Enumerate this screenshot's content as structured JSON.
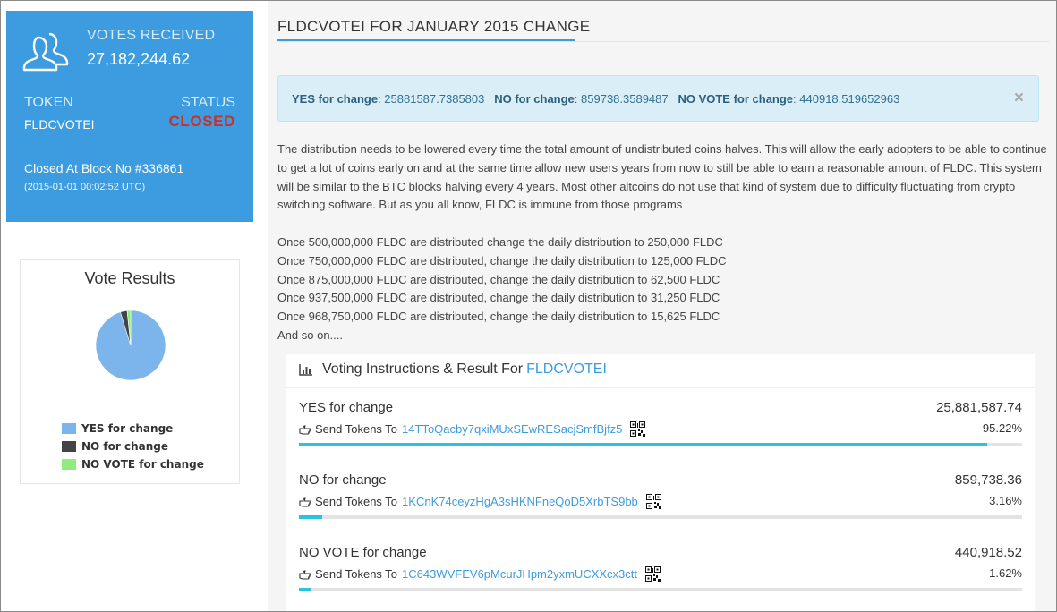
{
  "stat_card": {
    "votes_label": "VOTES RECEIVED",
    "votes_value": "27,182,244.62",
    "token_label": "TOKEN",
    "token_value": "FLDCVOTEI",
    "status_label": "STATUS",
    "status_value": "CLOSED",
    "closed_block": "Closed At Block No #336861",
    "closed_time": "(2015-01-01 00:02:52 UTC)",
    "card_color": "#3d9ce0",
    "status_color": "#c9302c"
  },
  "results": {
    "title": "Vote Results",
    "legend": [
      {
        "label": "YES for change",
        "color": "#7cb5ec"
      },
      {
        "label": "NO for change",
        "color": "#434348"
      },
      {
        "label": "NO VOTE for change",
        "color": "#90ed7d"
      }
    ]
  },
  "chart_data": {
    "type": "pie",
    "title": "Vote Results",
    "categories": [
      "YES for change",
      "NO for change",
      "NO VOTE for change"
    ],
    "values": [
      25881587.7385803,
      859738.3589487,
      440918.519652963
    ],
    "colors": [
      "#7cb5ec",
      "#434348",
      "#90ed7d"
    ],
    "legend": "bottom"
  },
  "main": {
    "page_title": "FLDCVOTEI FOR JANUARY 2015 CHANGE",
    "alert": {
      "yes_label": "YES for change",
      "yes_value": ": 25881587.7385803",
      "no_label": "NO for change",
      "no_value": ": 859738.3589487",
      "novote_label": "NO VOTE for change",
      "novote_value": ": 440918.519652963",
      "close": "×"
    },
    "description_lines": [
      "The distribution needs to be lowered every time the total amount of undistributed coins halves. This will allow the early adopters to be able to continue",
      "to get a lot of coins early on and at the same time allow new users years from now to still be able to earn a reasonable amount of FLDC. This system",
      "will be similar to the BTC blocks halving every 4 years. Most other altcoins do not use that kind of system due to difficulty fluctuating from crypto",
      "switching software. But as you all know, FLDC is immune from those programs"
    ],
    "distribution_lines": [
      "Once 500,000,000 FLDC are distributed change the daily distribution to 250,000 FLDC",
      "Once 750,000,000 FLDC are distributed, change the daily distribution to 125,000 FLDC",
      "Once 875,000,000 FLDC are distributed, change the daily distribution to 62,500 FLDC",
      "Once 937,500,000 FLDC are distributed, change the daily distribution to 31,250 FLDC",
      "Once 968,750,000 FLDC are distributed, change the daily distribution to 15,625 FLDC",
      "And so on...."
    ],
    "voting": {
      "header_prefix": "Voting Instructions & Result For",
      "header_token": "FLDCVOTEI",
      "send_label": "Send Tokens To",
      "options": [
        {
          "name": "YES for change",
          "amount": "25,881,587.74",
          "address": "14TToQacby7qxiMUxSEwRESacjSmfBjfz5",
          "percent_label": "95.22%",
          "percent": 95.22
        },
        {
          "name": "NO for change",
          "amount": "859,738.36",
          "address": "1KCnK74ceyzHgA3sHKNFneQoD5XrbTS9bb",
          "percent_label": "3.16%",
          "percent": 3.16
        },
        {
          "name": "NO VOTE for change",
          "amount": "440,918.52",
          "address": "1C643WVFEV6pMcurJHpm2yxmUCXXcx3ctt",
          "percent_label": "1.62%",
          "percent": 1.62
        }
      ]
    }
  }
}
